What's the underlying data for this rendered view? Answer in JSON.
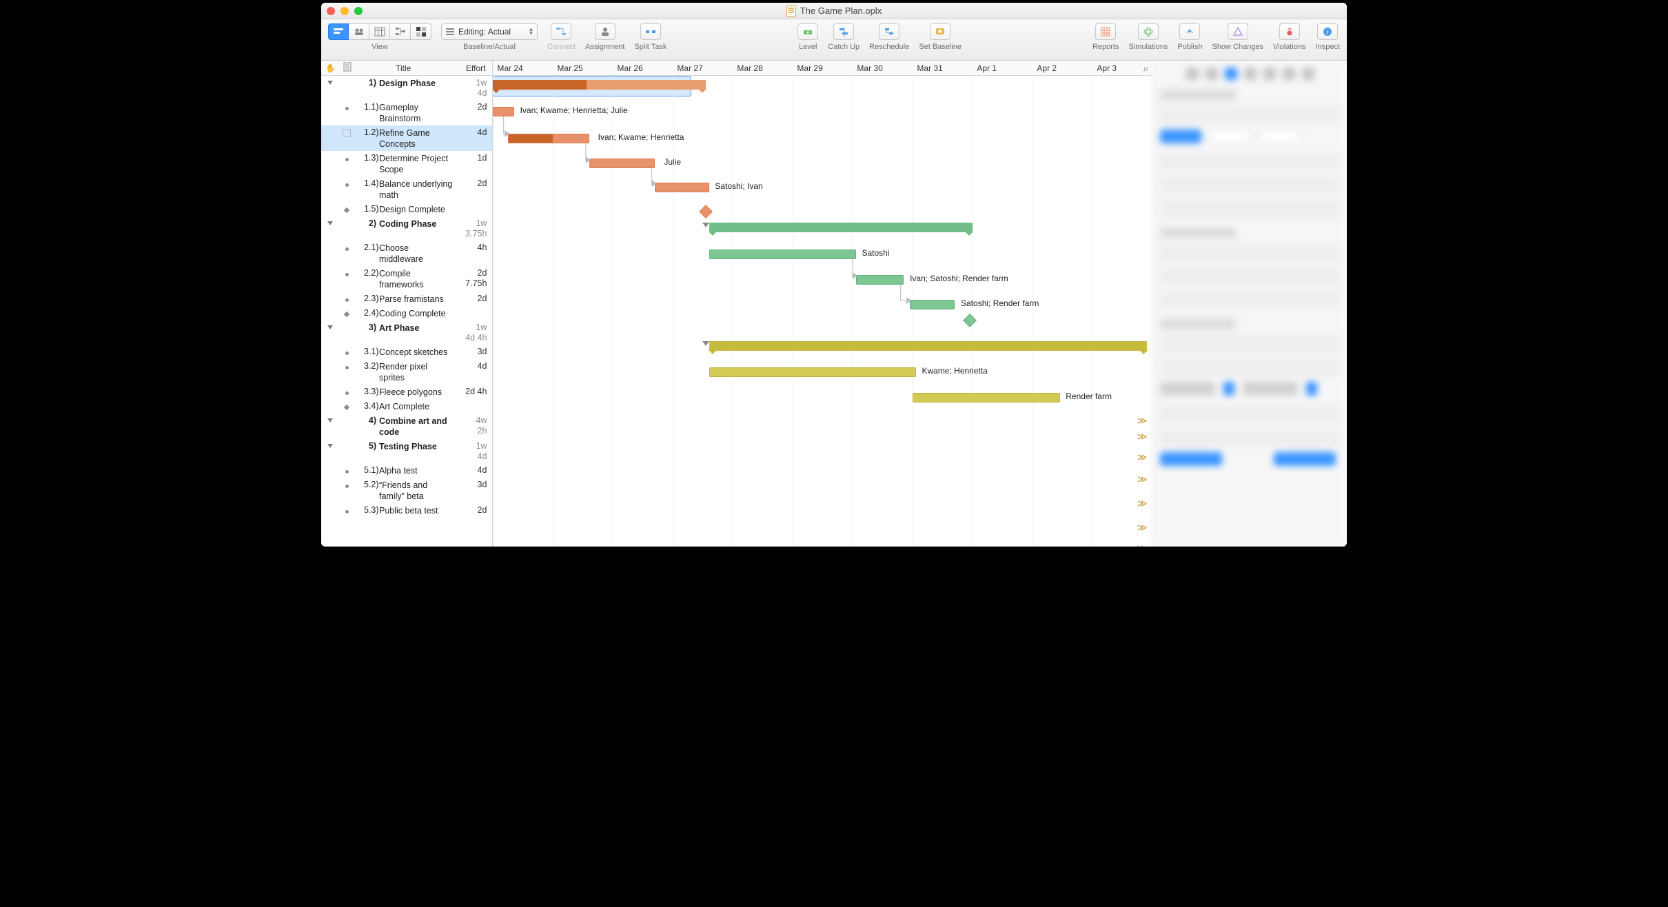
{
  "window": {
    "title": "The Game Plan.oplx"
  },
  "toolbar": {
    "view": {
      "label": "View"
    },
    "baseline": {
      "label": "Baseline/Actual",
      "dropdown": "Editing: Actual"
    },
    "connect": {
      "label": "Connect"
    },
    "assignment": {
      "label": "Assignment"
    },
    "split": {
      "label": "Split Task"
    },
    "level": {
      "label": "Level"
    },
    "catchup": {
      "label": "Catch Up"
    },
    "reschedule": {
      "label": "Reschedule"
    },
    "setbaseline": {
      "label": "Set Baseline"
    },
    "reports": {
      "label": "Reports"
    },
    "simulations": {
      "label": "Simulations"
    },
    "publish": {
      "label": "Publish"
    },
    "showchanges": {
      "label": "Show Changes"
    },
    "violations": {
      "label": "Violations"
    },
    "inspect": {
      "label": "Inspect"
    }
  },
  "outline": {
    "header": {
      "title": "Title",
      "effort": "Effort"
    },
    "rows": [
      {
        "type": "group",
        "num": "1)",
        "title": "Design Phase",
        "effort": "1w\n4d"
      },
      {
        "type": "task",
        "num": "1.1)",
        "title": "Gameplay Brainstorm",
        "effort": "2d"
      },
      {
        "type": "task",
        "num": "1.2)",
        "title": "Refine Game Concepts",
        "effort": "4d",
        "selected": true,
        "note": true
      },
      {
        "type": "task",
        "num": "1.3)",
        "title": "Determine Project Scope",
        "effort": "1d"
      },
      {
        "type": "task",
        "num": "1.4)",
        "title": "Balance underlying math",
        "effort": "2d"
      },
      {
        "type": "milestone",
        "num": "1.5)",
        "title": "Design Complete",
        "effort": ""
      },
      {
        "type": "group",
        "num": "2)",
        "title": "Coding Phase",
        "effort": "1w\n3.75h"
      },
      {
        "type": "task",
        "num": "2.1)",
        "title": "Choose middleware",
        "effort": "4h"
      },
      {
        "type": "task",
        "num": "2.2)",
        "title": "Compile frameworks",
        "effort": "2d\n7.75h"
      },
      {
        "type": "task",
        "num": "2.3)",
        "title": "Parse framistans",
        "effort": "2d"
      },
      {
        "type": "milestone",
        "num": "2.4)",
        "title": "Coding Complete",
        "effort": ""
      },
      {
        "type": "group",
        "num": "3)",
        "title": "Art Phase",
        "effort": "1w\n4d 4h"
      },
      {
        "type": "task",
        "num": "3.1)",
        "title": "Concept sketches",
        "effort": "3d"
      },
      {
        "type": "task",
        "num": "3.2)",
        "title": "Render pixel sprites",
        "effort": "4d"
      },
      {
        "type": "task",
        "num": "3.3)",
        "title": "Fleece polygons",
        "effort": "2d 4h"
      },
      {
        "type": "milestone",
        "num": "3.4)",
        "title": "Art Complete",
        "effort": ""
      },
      {
        "type": "group",
        "num": "4)",
        "title": "Combine art and code",
        "effort": "4w\n2h"
      },
      {
        "type": "group",
        "num": "5)",
        "title": "Testing Phase",
        "effort": "1w\n4d"
      },
      {
        "type": "task",
        "num": "5.1)",
        "title": "Alpha test",
        "effort": "4d"
      },
      {
        "type": "task",
        "num": "5.2)",
        "title": "“Friends and family” beta",
        "effort": "3d"
      },
      {
        "type": "task",
        "num": "5.3)",
        "title": "Public beta test",
        "effort": "2d"
      }
    ]
  },
  "gantt": {
    "dates": [
      "Mar 24",
      "Mar 25",
      "Mar 26",
      "Mar 27",
      "Mar 28",
      "Mar 29",
      "Mar 30",
      "Mar 31",
      "Apr 1",
      "Apr 2",
      "Apr 3"
    ],
    "labels": {
      "r11": "Ivan; Kwame; Henrietta; Julie",
      "r12": "Ivan; Kwame; Henrietta",
      "r13": "Julie",
      "r14": "Satoshi; Ivan",
      "r21": "Satoshi",
      "r22": "Ivan; Satoshi; Render farm",
      "r23": "Satoshi; Render farm",
      "r31": "Kwame; Henrietta",
      "r32": "Render farm"
    }
  }
}
